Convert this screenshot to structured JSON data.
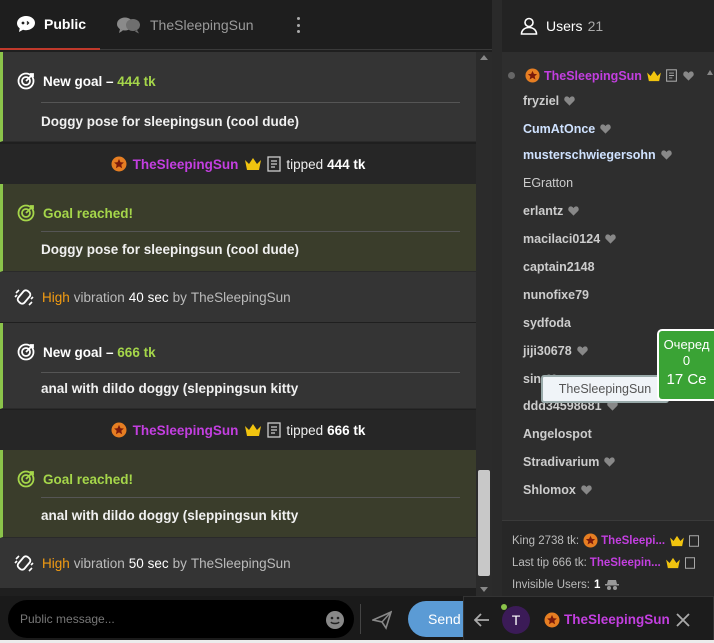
{
  "tabs": {
    "public": "Public",
    "private": "TheSleepingSun"
  },
  "messages": {
    "goal1": {
      "label": "New goal –",
      "amount": "444 tk",
      "desc": "Doggy pose for sleepingsun (cool dude)"
    },
    "tip1": {
      "user": "TheSleepingSun",
      "text": "tipped",
      "amount": "444 tk"
    },
    "reached1": {
      "label": "Goal reached!",
      "desc": "Doggy pose for sleepingsun (cool dude)"
    },
    "vib1": {
      "level": "High",
      "w1": "vibration",
      "time": "40 sec",
      "by": "by",
      "user": "TheSleepingSun"
    },
    "goal2": {
      "label": "New goal –",
      "amount": "666 tk",
      "desc": "anal with dildo doggy (sleppingsun kitty"
    },
    "tip2": {
      "user": "TheSleepingSun",
      "text": "tipped",
      "amount": "666 tk"
    },
    "reached2": {
      "label": "Goal reached!",
      "desc": "anal with dildo doggy (sleppingsun kitty"
    },
    "vib2": {
      "level": "High",
      "w1": "vibration",
      "time": "50 sec",
      "by": "by",
      "user": "TheSleepingSun"
    }
  },
  "input": {
    "placeholder": "Public message...",
    "send_label": "Send"
  },
  "users": {
    "title": "Users",
    "count": "21",
    "owner": "TheSleepingSun",
    "list": [
      "fryziel",
      "CumAtOnce",
      "musterschwiegersohn",
      "EGratton",
      "erlantz",
      "macilaci0124",
      "captain2148",
      "nunofixe79",
      "sydfoda",
      "jiji30678",
      "sin",
      "ddd34598681",
      "Angelospot",
      "Stradivarium",
      "Shlomox"
    ]
  },
  "tooltip": "TheSleepingSun",
  "queue": {
    "line1": "Очеред",
    "line2": "0",
    "line3": "17 Се"
  },
  "footer": {
    "king_label": "King 2738 tk:",
    "king_user": "TheSleepi...",
    "last_tip_label": "Last tip 666 tk:",
    "last_tip_user": "TheSleepin...",
    "invisible_label": "Invisible Users:",
    "invisible_count": "1"
  },
  "pm": {
    "avatar_letter": "T",
    "user": "TheSleepingSun"
  },
  "colors": {
    "accent_green": "#a5d64a",
    "username_purple": "#c33fe0",
    "vibration_orange": "#f39c12",
    "send_blue": "#5b9bd5"
  }
}
